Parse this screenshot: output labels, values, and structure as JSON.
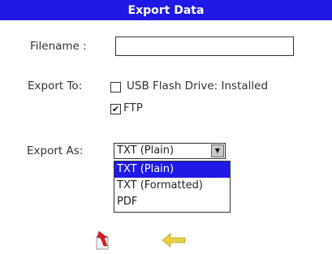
{
  "window": {
    "title": "Export Data"
  },
  "form": {
    "filename_label": "Filename :",
    "filename_value": "",
    "export_to_label": "Export To:",
    "export_as_label": "Export As:"
  },
  "destinations": [
    {
      "label": "USB Flash Drive: Installed",
      "checked": false
    },
    {
      "label": "FTP",
      "checked": true
    }
  ],
  "format_select": {
    "selected": "TXT (Plain)",
    "options": [
      "TXT (Plain)",
      "TXT (Formatted)",
      "PDF"
    ],
    "highlighted_index": 0
  },
  "actions": [
    {
      "name": "export-icon",
      "icon": "export-arrow"
    },
    {
      "name": "back-icon",
      "icon": "back-arrow"
    }
  ],
  "colors": {
    "title_bar": "#1f18e6",
    "highlight": "#1f18e6",
    "export_icon": "#d62020",
    "back_icon": "#e8d040"
  }
}
